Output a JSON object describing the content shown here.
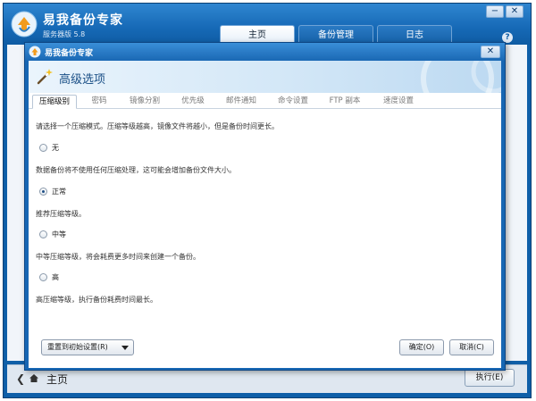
{
  "app": {
    "title": "易我备份专家",
    "edition": "服务器版 5.8",
    "tabs": [
      {
        "label": "主页",
        "active": true
      },
      {
        "label": "备份管理",
        "active": false
      },
      {
        "label": "日志",
        "active": false
      }
    ],
    "window_buttons": {
      "minimize": "−",
      "close": "✕"
    },
    "help_glyph": "?",
    "footer": {
      "back_glyph": "❮",
      "home_label": "主页",
      "execute_label": "执行(E)"
    }
  },
  "dialog": {
    "title": "易我备份专家",
    "close_glyph": "✕",
    "heading": "高级选项",
    "tabs": [
      {
        "label": "压缩级别",
        "active": true
      },
      {
        "label": "密码",
        "active": false
      },
      {
        "label": "镜像分割",
        "active": false
      },
      {
        "label": "优先级",
        "active": false
      },
      {
        "label": "邮件通知",
        "active": false
      },
      {
        "label": "命令设置",
        "active": false
      },
      {
        "label": "FTP 副本",
        "active": false
      },
      {
        "label": "速度设置",
        "active": false
      }
    ],
    "intro": "请选择一个压缩模式。压缩等级越高，镜像文件将越小，但是备份时间更长。",
    "options": [
      {
        "label": "无",
        "checked": false,
        "description": "数据备份将不使用任何压缩处理，这可能会增加备份文件大小。"
      },
      {
        "label": "正常",
        "checked": true,
        "description": "推荐压缩等级。"
      },
      {
        "label": "中等",
        "checked": false,
        "description": "中等压缩等级，将会耗费更多时间来创建一个备份。"
      },
      {
        "label": "高",
        "checked": false,
        "description": "高压缩等级，执行备份耗费时间最长。"
      }
    ],
    "buttons": {
      "reset": "重置到初始设置(R)",
      "ok": "确定(O)",
      "cancel": "取消(C)"
    }
  },
  "colors": {
    "app_blue": "#1766b3",
    "banner_light": "#d3e7f7",
    "heading_text": "#1a4f86"
  }
}
